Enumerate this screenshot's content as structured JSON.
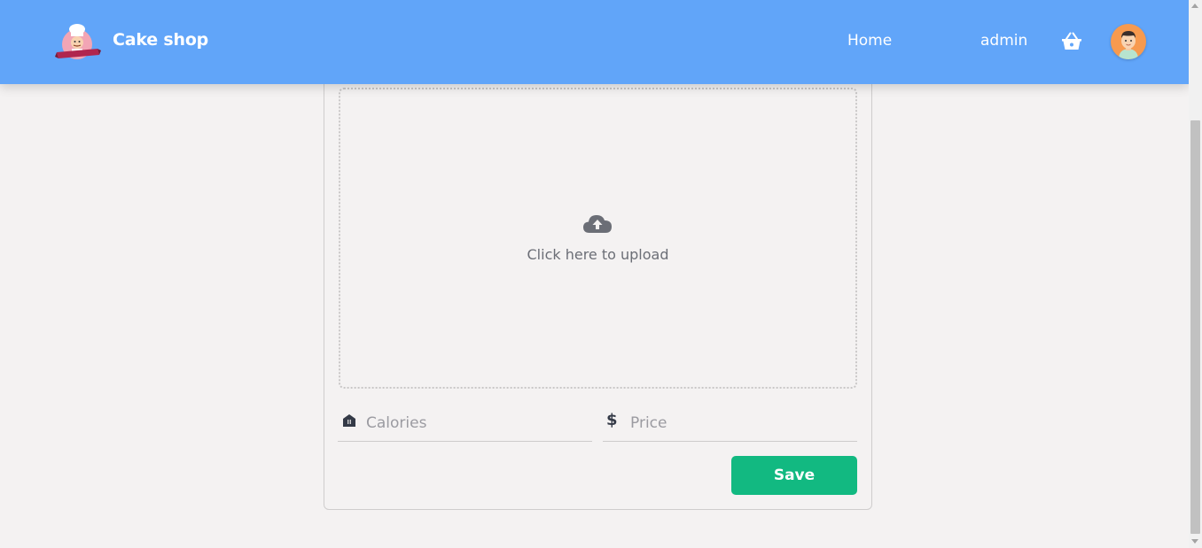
{
  "header": {
    "brand": "Cake shop",
    "nav_home": "Home",
    "user_name": "admin",
    "cart_icon": "basket-icon",
    "avatar_icon": "user-avatar-icon",
    "logo_icon": "chef-logo-icon",
    "background_color": "#61a5f9"
  },
  "form": {
    "upload_text": "Click here to upload",
    "upload_icon": "cloud-upload-icon",
    "calories": {
      "placeholder": "Calories",
      "value": "",
      "icon": "building-icon"
    },
    "price": {
      "placeholder": "Price",
      "value": "",
      "icon": "dollar-icon"
    },
    "save_label": "Save",
    "save_color": "#12b981"
  }
}
